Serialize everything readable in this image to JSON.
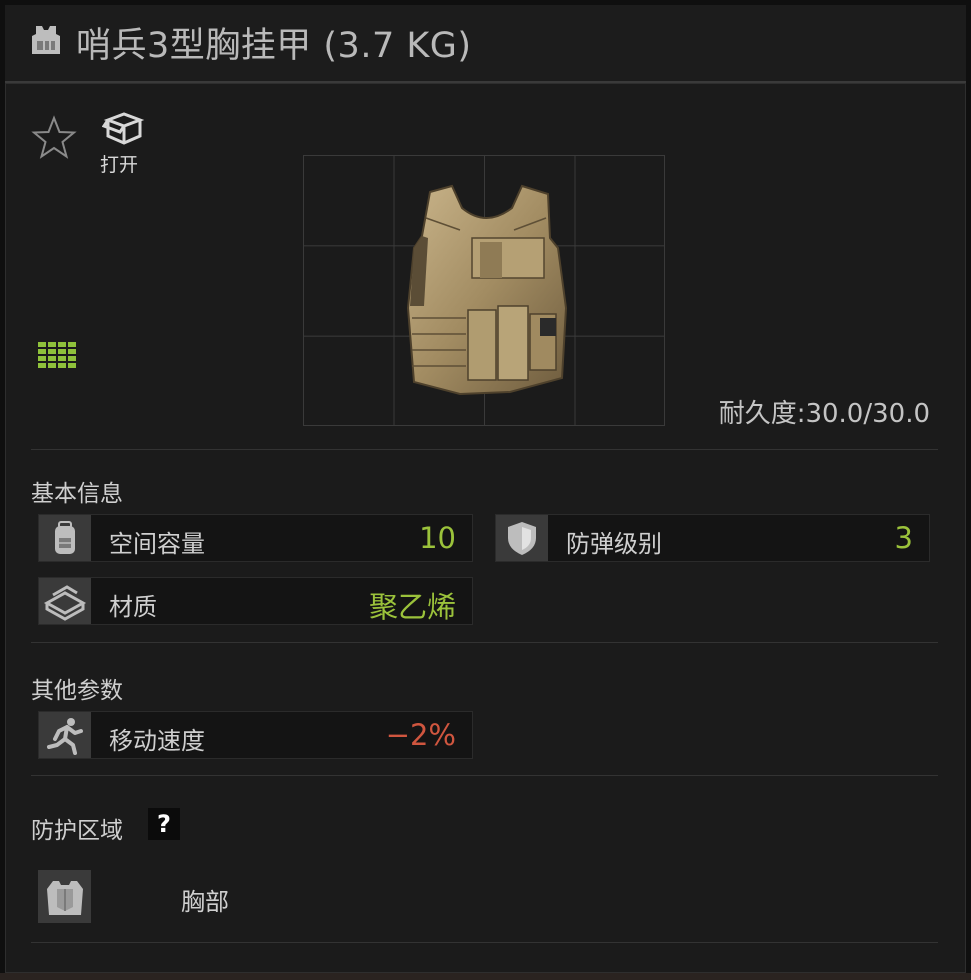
{
  "window": {
    "title": "哨兵3型胸挂甲 (3.7 KG)"
  },
  "actions": {
    "open_label": "打开"
  },
  "item": {
    "durability_label": "耐久度:",
    "durability_value": "30.0/30.0"
  },
  "sections": {
    "basic": {
      "title": "基本信息",
      "stats": [
        {
          "label": "空间容量",
          "value": "10",
          "icon": "backpack-icon"
        },
        {
          "label": "防弹级别",
          "value": "3",
          "icon": "shield-icon"
        },
        {
          "label": "材质",
          "value": "聚乙烯",
          "icon": "material-plates-icon"
        }
      ]
    },
    "other": {
      "title": "其他参数",
      "stats": [
        {
          "label": "移动速度",
          "value": "−2%",
          "icon": "running-man-icon"
        }
      ]
    },
    "protection": {
      "title": "防护区域",
      "help": "?",
      "zones": [
        {
          "label": "胸部",
          "icon": "chest-armor-icon"
        }
      ]
    }
  },
  "colors": {
    "positive": "#9bc23b",
    "negative": "#d0563f",
    "grid_icon": "#8fc23b"
  }
}
